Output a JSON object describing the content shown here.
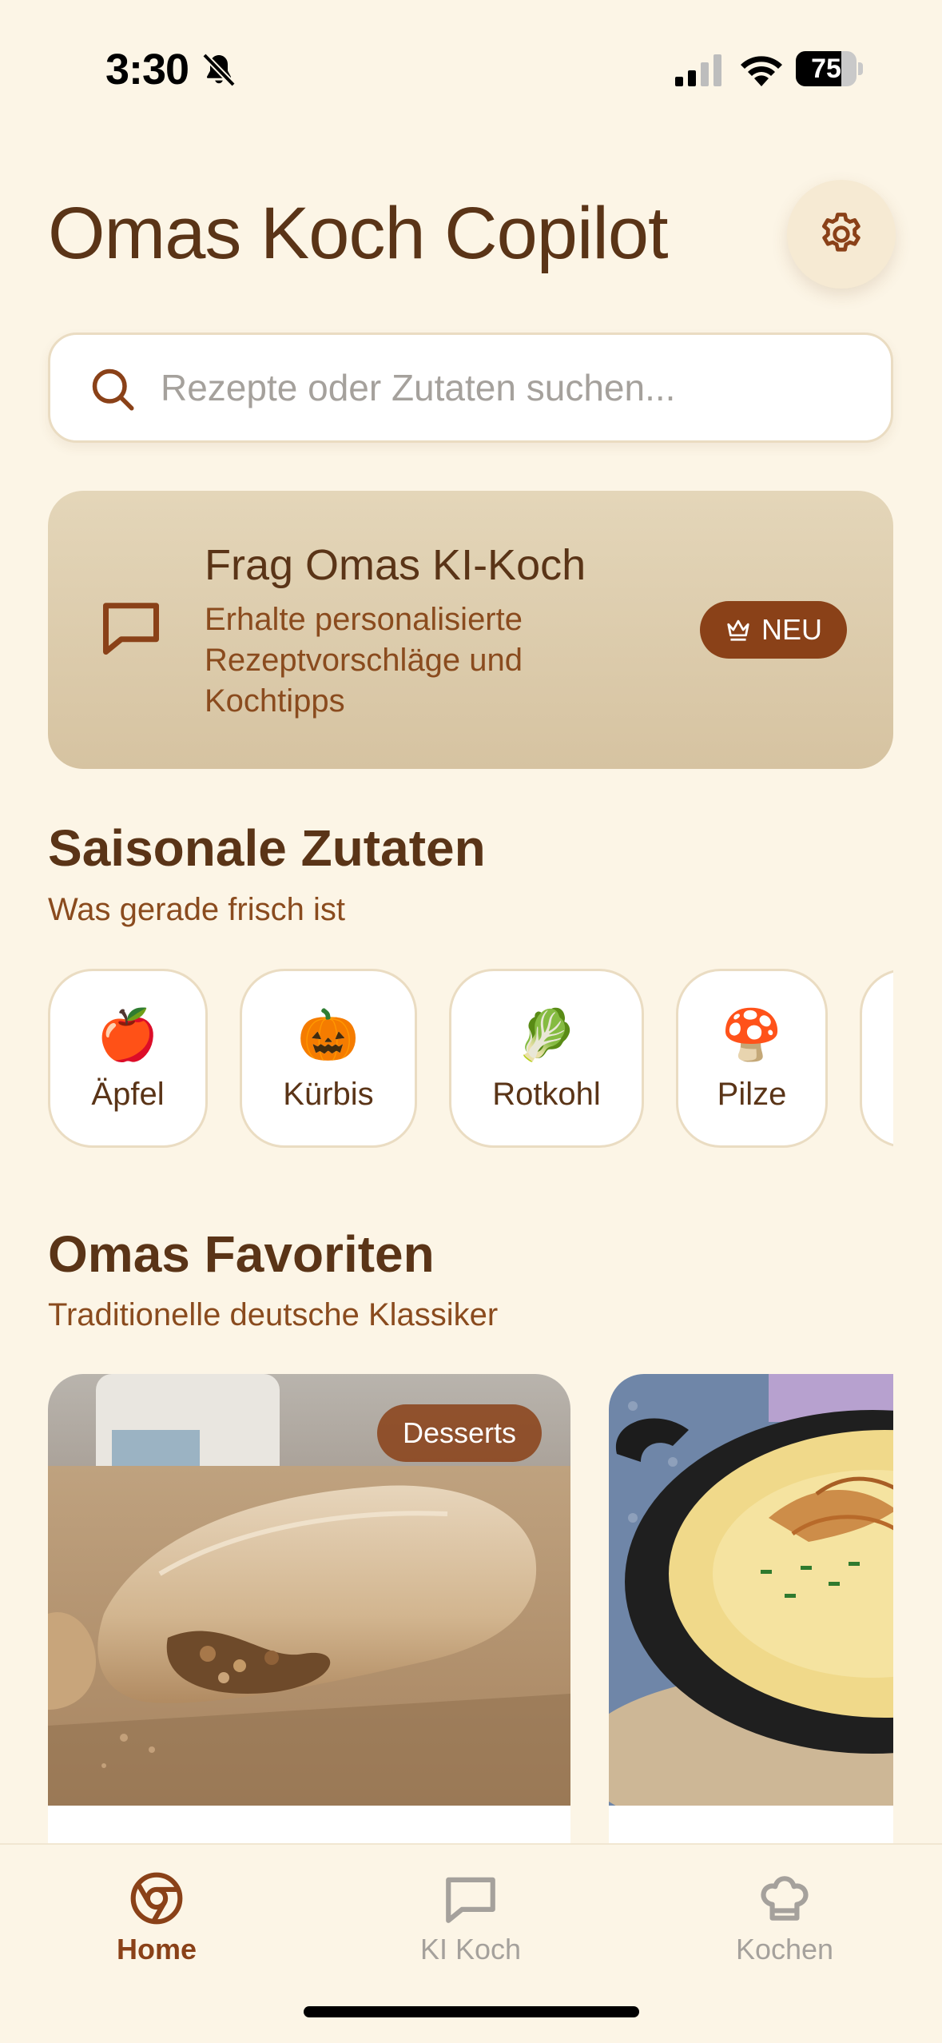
{
  "status_bar": {
    "time": "3:30",
    "battery": "75",
    "battery_level": 0.75,
    "icons": [
      "bell-slash-icon",
      "cellular-signal-icon",
      "wifi-icon",
      "battery-icon"
    ]
  },
  "header": {
    "title": "Omas Koch Copilot",
    "settings_icon": "gear-icon"
  },
  "search": {
    "placeholder": "Rezepte oder Zutaten suchen...",
    "value": "",
    "icon": "search-icon"
  },
  "ai_card": {
    "title": "Frag Omas KI-Koch",
    "description": "Erhalte personalisierte Rezeptvorschläge und Kochtipps",
    "badge": "NEU",
    "icon": "chat-bubble-icon",
    "badge_icon": "crown-icon"
  },
  "seasonal": {
    "title": "Saisonale Zutaten",
    "subtitle": "Was gerade frisch ist",
    "items": [
      {
        "emoji": "🍎",
        "label": "Äpfel"
      },
      {
        "emoji": "🎃",
        "label": "Kürbis"
      },
      {
        "emoji": "🥬",
        "label": "Rotkohl"
      },
      {
        "emoji": "🍄",
        "label": "Pilze"
      },
      {
        "emoji": "",
        "label": ""
      }
    ]
  },
  "favorites": {
    "title": "Omas Favoriten",
    "subtitle": "Traditionelle deutsche Klassiker",
    "recipes": [
      {
        "category": "Desserts",
        "image": "apple-strudel-photo"
      },
      {
        "category": "",
        "image": "cheese-spaetzle-pan-photo"
      }
    ]
  },
  "tab_bar": {
    "tabs": [
      {
        "label": "Home",
        "icon": "home-icon",
        "active": true
      },
      {
        "label": "KI Koch",
        "icon": "chat-bubble-icon",
        "active": false
      },
      {
        "label": "Kochen",
        "icon": "chef-hat-icon",
        "active": false
      }
    ]
  },
  "colors": {
    "background": "#fcf5e6",
    "primary_text": "#5a3417",
    "accent": "#8a4118",
    "secondary_text": "#8a4b1e",
    "inactive": "#a5a19c"
  }
}
